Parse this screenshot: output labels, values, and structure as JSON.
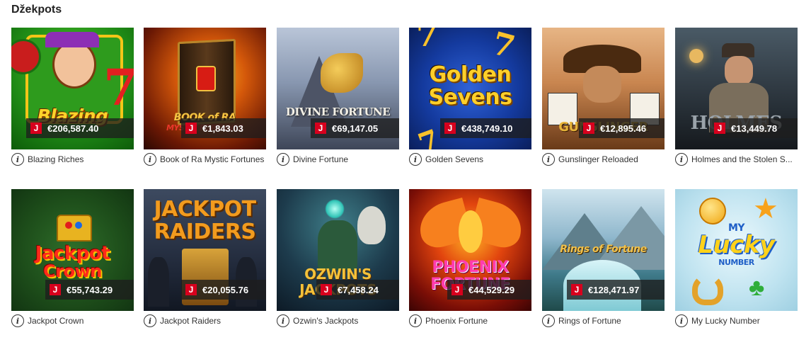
{
  "section": {
    "title": "Džekpots"
  },
  "jackpot_badge": "J",
  "info_glyph": "i",
  "games": [
    {
      "name": "Blazing Riches",
      "jackpot": "€206,587.40",
      "logo": "Blazing Riches",
      "bg": "#1c8a1a"
    },
    {
      "name": "Book of Ra Mystic Fortunes",
      "jackpot": "€1,843.03",
      "logo": "Book of Ra",
      "bg": "#7a1e05"
    },
    {
      "name": "Divine Fortune",
      "jackpot": "€69,147.05",
      "logo": "Divine Fortune",
      "bg": "#7f8fa8"
    },
    {
      "name": "Golden Sevens",
      "jackpot": "€438,749.10",
      "logo": "Golden Sevens",
      "bg": "#0d2f8a"
    },
    {
      "name": "Gunslinger Reloaded",
      "jackpot": "€12,895.46",
      "logo": "Gunslinger Reloaded",
      "bg": "#a4622c"
    },
    {
      "name": "Holmes and the Stolen S...",
      "jackpot": "€13,449.78",
      "logo": "Holmes",
      "bg": "#2d3a45"
    },
    {
      "name": "Jackpot Crown",
      "jackpot": "€55,743.29",
      "logo": "Jackpot Crown",
      "bg": "#1f5a1d"
    },
    {
      "name": "Jackpot Raiders",
      "jackpot": "€20,055.76",
      "logo": "Jackpot Raiders",
      "bg": "#2b3548"
    },
    {
      "name": "Ozwin's Jackpots",
      "jackpot": "€7,458.24",
      "logo": "Ozwin's Jackpots",
      "bg": "#1b3a4a"
    },
    {
      "name": "Phoenix Fortune",
      "jackpot": "€44,529.29",
      "logo": "Phoenix Fortune",
      "bg": "#8a1408"
    },
    {
      "name": "Rings of Fortune",
      "jackpot": "€128,471.97",
      "logo": "Rings of Fortune",
      "bg": "#5d8fa8"
    },
    {
      "name": "My Lucky Number",
      "jackpot": "",
      "logo": "My Lucky Number",
      "bg": "#bfe3f0"
    }
  ]
}
